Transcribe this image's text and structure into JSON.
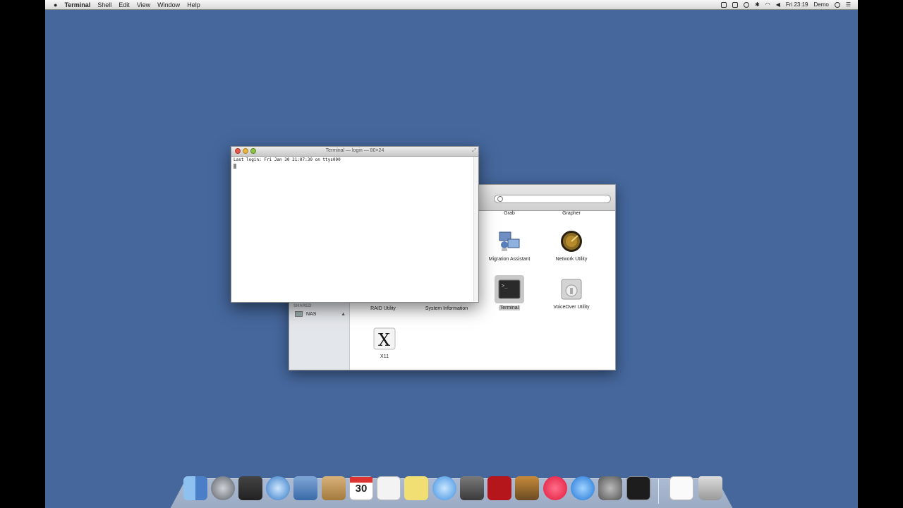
{
  "menubar": {
    "apple": "",
    "app": "Terminal",
    "items": [
      "Shell",
      "Edit",
      "View",
      "Window",
      "Help"
    ],
    "clock": "Fri 23:19",
    "user": "Demo"
  },
  "terminal": {
    "title": "Terminal — login — 80×24",
    "line1": "Last login: Fri Jan 30 21:07:30 on ttys000"
  },
  "finder": {
    "top_labels": [
      "Grab",
      "Grapher"
    ],
    "sidebar_section": "SHARED",
    "sidebar_item": "NAS",
    "items": [
      {
        "label": "Migration Assistant",
        "icon": "migration-assistant-icon"
      },
      {
        "label": "Network Utility",
        "icon": "network-utility-icon"
      },
      {
        "label": "RAID Utility",
        "icon": "raid-utility-icon"
      },
      {
        "label": "System Information",
        "icon": "system-information-icon"
      },
      {
        "label": "Terminal",
        "icon": "terminal-icon"
      },
      {
        "label": "VoiceOver Utility",
        "icon": "voiceover-utility-icon"
      },
      {
        "label": "X11",
        "icon": "x11-icon"
      }
    ]
  },
  "dock": {
    "items": [
      "finder",
      "launchpad",
      "dashboard",
      "safari",
      "mail",
      "contacts",
      "calendar",
      "reminders",
      "notes",
      "messages",
      "facetime",
      "photo-booth",
      "iphoto",
      "itunes",
      "app-store",
      "system-preferences",
      "terminal",
      "document",
      "trash"
    ],
    "calendar_day": "30"
  },
  "colors": {
    "desktop": "#45679c",
    "selection": "#c8c8c8"
  }
}
